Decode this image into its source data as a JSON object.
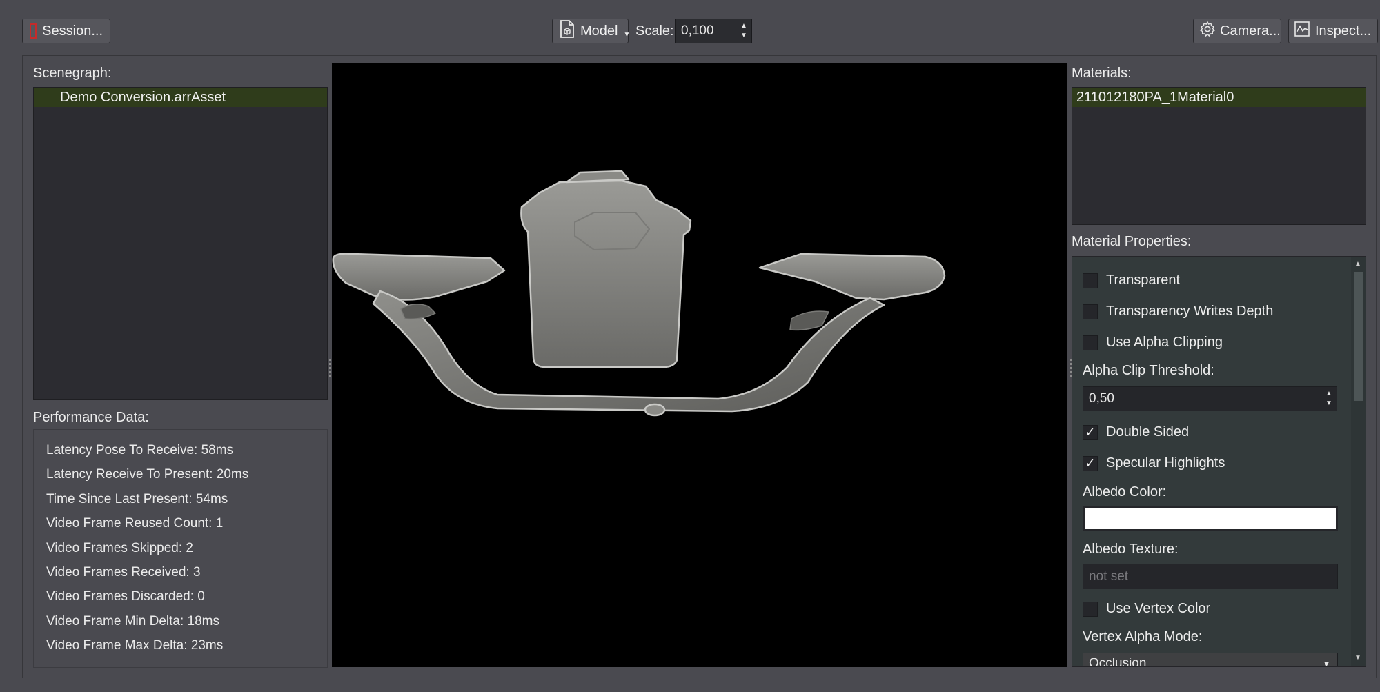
{
  "toolbar": {
    "session_label": "Session...",
    "model_label": "Model",
    "scale_label": "Scale:",
    "scale_value": "0,100",
    "camera_label": "Camera...",
    "inspect_label": "Inspect..."
  },
  "scenegraph": {
    "title": "Scenegraph:",
    "items": [
      "Demo Conversion.arrAsset"
    ]
  },
  "performance": {
    "title": "Performance Data:",
    "lines": [
      "Latency Pose To Receive: 58ms",
      "Latency Receive To Present: 20ms",
      "Time Since Last Present: 54ms",
      "Video Frame Reused Count: 1",
      "Video Frames Skipped: 2",
      "Video Frames Received: 3",
      "Video Frames Discarded: 0",
      "Video Frame Min Delta: 18ms",
      "Video Frame Max Delta: 23ms"
    ]
  },
  "materials": {
    "title": "Materials:",
    "items": [
      "211012180PA_1Material0"
    ]
  },
  "material_properties": {
    "title": "Material Properties:",
    "transparent": {
      "label": "Transparent",
      "checked": false
    },
    "transparency_writes_depth": {
      "label": "Transparency Writes Depth",
      "checked": false
    },
    "use_alpha_clipping": {
      "label": "Use Alpha Clipping",
      "checked": false
    },
    "alpha_clip_threshold_label": "Alpha Clip Threshold:",
    "alpha_clip_threshold_value": "0,50",
    "double_sided": {
      "label": "Double Sided",
      "checked": true
    },
    "specular_highlights": {
      "label": "Specular Highlights",
      "checked": true
    },
    "albedo_color_label": "Albedo Color:",
    "albedo_color_value": "#ffffff",
    "albedo_texture_label": "Albedo Texture:",
    "albedo_texture_placeholder": "not set",
    "use_vertex_color": {
      "label": "Use Vertex Color",
      "checked": false
    },
    "vertex_alpha_mode_label": "Vertex Alpha Mode:",
    "vertex_alpha_mode_value": "Occlusion"
  },
  "icons": {
    "session": "session-icon",
    "model": "model-file-icon",
    "camera": "gear-icon",
    "inspect": "chart-icon"
  },
  "colors": {
    "selection": "#2f3c1b",
    "session_icon": "#c42b2b"
  }
}
